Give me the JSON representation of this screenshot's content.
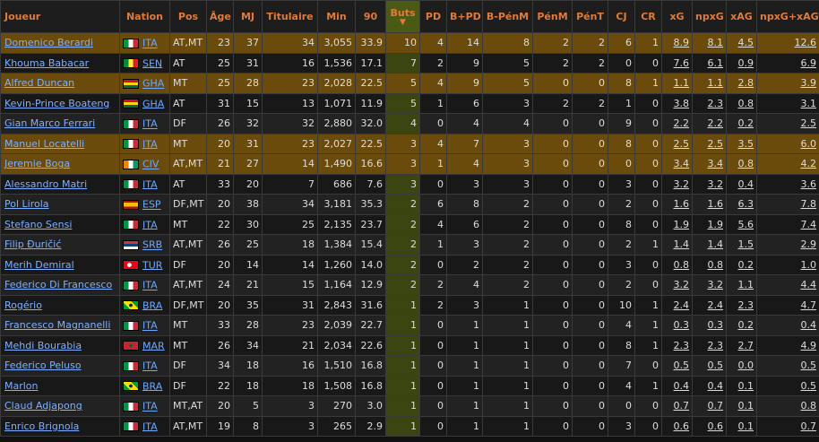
{
  "headers": {
    "player": "Joueur",
    "nation": "Nation",
    "pos": "Pos",
    "age": "Âge",
    "mj": "MJ",
    "tit": "Titulaire",
    "min": "Min",
    "n90": "90",
    "buts": "Buts",
    "sort_arrow": "▼",
    "pd": "PD",
    "bpd": "B+PD",
    "bpenm": "B-PénM",
    "penm": "PénM",
    "pent": "PénT",
    "cj": "CJ",
    "cr": "CR",
    "xg": "xG",
    "npxg": "npxG",
    "xag": "xAG",
    "npxgxag": "npxG+xAG"
  },
  "flags": {
    "ITA": {
      "type": "v",
      "colors": [
        "#009246",
        "#ffffff",
        "#ce2b37"
      ]
    },
    "SEN": {
      "type": "v",
      "colors": [
        "#00853f",
        "#fdef42",
        "#e31b23"
      ],
      "star": "#00853f"
    },
    "GHA": {
      "type": "h",
      "colors": [
        "#ce1126",
        "#fcd116",
        "#006b3f"
      ],
      "star": "#000000"
    },
    "CIV": {
      "type": "v",
      "colors": [
        "#f77f00",
        "#ffffff",
        "#009e60"
      ]
    },
    "ESP": {
      "type": "h3",
      "colors": [
        "#aa151b",
        "#f1bf00",
        "#aa151b"
      ]
    },
    "SRB": {
      "type": "h",
      "colors": [
        "#c6363c",
        "#0c4076",
        "#ffffff"
      ]
    },
    "TUR": {
      "type": "tur",
      "colors": [
        "#e30a17",
        "#ffffff"
      ]
    },
    "BRA": {
      "type": "bra",
      "colors": [
        "#009c3b",
        "#ffdf00",
        "#002776"
      ]
    },
    "MAR": {
      "type": "mar",
      "colors": [
        "#c1272d",
        "#006233"
      ]
    }
  },
  "rows": [
    {
      "name": "Domenico Berardi",
      "nat": "ITA",
      "pos": "AT,MT",
      "age": "23",
      "mj": "37",
      "tit": "34",
      "min": "3,055",
      "n90": "33.9",
      "buts": "10",
      "pd": "4",
      "bpd": "14",
      "bpenm": "8",
      "penm": "2",
      "pent": "2",
      "cj": "6",
      "cr": "1",
      "xg": "8.9",
      "npxg": "8.1",
      "xag": "4.5",
      "npxgxag": "12.6",
      "hl": true
    },
    {
      "name": "Khouma Babacar",
      "nat": "SEN",
      "pos": "AT",
      "age": "25",
      "mj": "31",
      "tit": "16",
      "min": "1,536",
      "n90": "17.1",
      "buts": "7",
      "pd": "2",
      "bpd": "9",
      "bpenm": "5",
      "penm": "2",
      "pent": "2",
      "cj": "0",
      "cr": "0",
      "xg": "7.6",
      "npxg": "6.1",
      "xag": "0.9",
      "npxgxag": "6.9",
      "hl": false
    },
    {
      "name": "Alfred Duncan",
      "nat": "GHA",
      "pos": "MT",
      "age": "25",
      "mj": "28",
      "tit": "23",
      "min": "2,028",
      "n90": "22.5",
      "buts": "5",
      "pd": "4",
      "bpd": "9",
      "bpenm": "5",
      "penm": "0",
      "pent": "0",
      "cj": "8",
      "cr": "1",
      "xg": "1.1",
      "npxg": "1.1",
      "xag": "2.8",
      "npxgxag": "3.9",
      "hl": true
    },
    {
      "name": "Kevin-Prince Boateng",
      "nat": "GHA",
      "pos": "AT",
      "age": "31",
      "mj": "15",
      "tit": "13",
      "min": "1,071",
      "n90": "11.9",
      "buts": "5",
      "pd": "1",
      "bpd": "6",
      "bpenm": "3",
      "penm": "2",
      "pent": "2",
      "cj": "1",
      "cr": "0",
      "xg": "3.8",
      "npxg": "2.3",
      "xag": "0.8",
      "npxgxag": "3.1",
      "hl": false
    },
    {
      "name": "Gian Marco Ferrari",
      "nat": "ITA",
      "pos": "DF",
      "age": "26",
      "mj": "32",
      "tit": "32",
      "min": "2,880",
      "n90": "32.0",
      "buts": "4",
      "pd": "0",
      "bpd": "4",
      "bpenm": "4",
      "penm": "0",
      "pent": "0",
      "cj": "9",
      "cr": "0",
      "xg": "2.2",
      "npxg": "2.2",
      "xag": "0.2",
      "npxgxag": "2.5",
      "hl": false
    },
    {
      "name": "Manuel Locatelli",
      "nat": "ITA",
      "pos": "MT",
      "age": "20",
      "mj": "31",
      "tit": "23",
      "min": "2,027",
      "n90": "22.5",
      "buts": "3",
      "pd": "4",
      "bpd": "7",
      "bpenm": "3",
      "penm": "0",
      "pent": "0",
      "cj": "8",
      "cr": "0",
      "xg": "2.5",
      "npxg": "2.5",
      "xag": "3.5",
      "npxgxag": "6.0",
      "hl": true
    },
    {
      "name": "Jeremie Boga",
      "nat": "CIV",
      "pos": "AT,MT",
      "age": "21",
      "mj": "27",
      "tit": "14",
      "min": "1,490",
      "n90": "16.6",
      "buts": "3",
      "pd": "1",
      "bpd": "4",
      "bpenm": "3",
      "penm": "0",
      "pent": "0",
      "cj": "0",
      "cr": "0",
      "xg": "3.4",
      "npxg": "3.4",
      "xag": "0.8",
      "npxgxag": "4.2",
      "hl": true
    },
    {
      "name": "Alessandro Matri",
      "nat": "ITA",
      "pos": "AT",
      "age": "33",
      "mj": "20",
      "tit": "7",
      "min": "686",
      "n90": "7.6",
      "buts": "3",
      "pd": "0",
      "bpd": "3",
      "bpenm": "3",
      "penm": "0",
      "pent": "0",
      "cj": "3",
      "cr": "0",
      "xg": "3.2",
      "npxg": "3.2",
      "xag": "0.4",
      "npxgxag": "3.6",
      "hl": false
    },
    {
      "name": "Pol Lirola",
      "nat": "ESP",
      "pos": "DF,MT",
      "age": "20",
      "mj": "38",
      "tit": "34",
      "min": "3,181",
      "n90": "35.3",
      "buts": "2",
      "pd": "6",
      "bpd": "8",
      "bpenm": "2",
      "penm": "0",
      "pent": "0",
      "cj": "2",
      "cr": "0",
      "xg": "1.6",
      "npxg": "1.6",
      "xag": "6.3",
      "npxgxag": "7.8",
      "hl": false
    },
    {
      "name": "Stefano Sensi",
      "nat": "ITA",
      "pos": "MT",
      "age": "22",
      "mj": "30",
      "tit": "25",
      "min": "2,135",
      "n90": "23.7",
      "buts": "2",
      "pd": "4",
      "bpd": "6",
      "bpenm": "2",
      "penm": "0",
      "pent": "0",
      "cj": "8",
      "cr": "0",
      "xg": "1.9",
      "npxg": "1.9",
      "xag": "5.6",
      "npxgxag": "7.4",
      "hl": false
    },
    {
      "name": "Filip Đuričić",
      "nat": "SRB",
      "pos": "AT,MT",
      "age": "26",
      "mj": "25",
      "tit": "18",
      "min": "1,384",
      "n90": "15.4",
      "buts": "2",
      "pd": "1",
      "bpd": "3",
      "bpenm": "2",
      "penm": "0",
      "pent": "0",
      "cj": "2",
      "cr": "1",
      "xg": "1.4",
      "npxg": "1.4",
      "xag": "1.5",
      "npxgxag": "2.9",
      "hl": false
    },
    {
      "name": "Merih Demiral",
      "nat": "TUR",
      "pos": "DF",
      "age": "20",
      "mj": "14",
      "tit": "14",
      "min": "1,260",
      "n90": "14.0",
      "buts": "2",
      "pd": "0",
      "bpd": "2",
      "bpenm": "2",
      "penm": "0",
      "pent": "0",
      "cj": "3",
      "cr": "0",
      "xg": "0.8",
      "npxg": "0.8",
      "xag": "0.2",
      "npxgxag": "1.0",
      "hl": false
    },
    {
      "name": "Federico Di Francesco",
      "nat": "ITA",
      "pos": "AT,MT",
      "age": "24",
      "mj": "21",
      "tit": "15",
      "min": "1,164",
      "n90": "12.9",
      "buts": "2",
      "pd": "2",
      "bpd": "4",
      "bpenm": "2",
      "penm": "0",
      "pent": "0",
      "cj": "2",
      "cr": "0",
      "xg": "3.2",
      "npxg": "3.2",
      "xag": "1.1",
      "npxgxag": "4.4",
      "hl": false
    },
    {
      "name": "Rogério",
      "nat": "BRA",
      "pos": "DF,MT",
      "age": "20",
      "mj": "35",
      "tit": "31",
      "min": "2,843",
      "n90": "31.6",
      "buts": "1",
      "pd": "2",
      "bpd": "3",
      "bpenm": "1",
      "penm": "0",
      "pent": "0",
      "cj": "10",
      "cr": "1",
      "xg": "2.4",
      "npxg": "2.4",
      "xag": "2.3",
      "npxgxag": "4.7",
      "hl": false
    },
    {
      "name": "Francesco Magnanelli",
      "nat": "ITA",
      "pos": "MT",
      "age": "33",
      "mj": "28",
      "tit": "23",
      "min": "2,039",
      "n90": "22.7",
      "buts": "1",
      "pd": "0",
      "bpd": "1",
      "bpenm": "1",
      "penm": "0",
      "pent": "0",
      "cj": "4",
      "cr": "1",
      "xg": "0.3",
      "npxg": "0.3",
      "xag": "0.2",
      "npxgxag": "0.4",
      "hl": false
    },
    {
      "name": "Mehdi Bourabia",
      "nat": "MAR",
      "pos": "MT",
      "age": "26",
      "mj": "34",
      "tit": "21",
      "min": "2,034",
      "n90": "22.6",
      "buts": "1",
      "pd": "0",
      "bpd": "1",
      "bpenm": "1",
      "penm": "0",
      "pent": "0",
      "cj": "8",
      "cr": "1",
      "xg": "2.3",
      "npxg": "2.3",
      "xag": "2.7",
      "npxgxag": "4.9",
      "hl": false
    },
    {
      "name": "Federico Peluso",
      "nat": "ITA",
      "pos": "DF",
      "age": "34",
      "mj": "18",
      "tit": "16",
      "min": "1,510",
      "n90": "16.8",
      "buts": "1",
      "pd": "0",
      "bpd": "1",
      "bpenm": "1",
      "penm": "0",
      "pent": "0",
      "cj": "7",
      "cr": "0",
      "xg": "0.5",
      "npxg": "0.5",
      "xag": "0.0",
      "npxgxag": "0.5",
      "hl": false
    },
    {
      "name": "Marlon",
      "nat": "BRA",
      "pos": "DF",
      "age": "22",
      "mj": "18",
      "tit": "18",
      "min": "1,508",
      "n90": "16.8",
      "buts": "1",
      "pd": "0",
      "bpd": "1",
      "bpenm": "1",
      "penm": "0",
      "pent": "0",
      "cj": "4",
      "cr": "1",
      "xg": "0.4",
      "npxg": "0.4",
      "xag": "0.1",
      "npxgxag": "0.5",
      "hl": false
    },
    {
      "name": "Claud Adjapong",
      "nat": "ITA",
      "pos": "MT,AT",
      "age": "20",
      "mj": "5",
      "tit": "3",
      "min": "270",
      "n90": "3.0",
      "buts": "1",
      "pd": "0",
      "bpd": "1",
      "bpenm": "1",
      "penm": "0",
      "pent": "0",
      "cj": "0",
      "cr": "0",
      "xg": "0.7",
      "npxg": "0.7",
      "xag": "0.1",
      "npxgxag": "0.8",
      "hl": false
    },
    {
      "name": "Enrico Brignola",
      "nat": "ITA",
      "pos": "AT,MT",
      "age": "19",
      "mj": "8",
      "tit": "3",
      "min": "265",
      "n90": "2.9",
      "buts": "1",
      "pd": "0",
      "bpd": "1",
      "bpenm": "1",
      "penm": "0",
      "pent": "0",
      "cj": "3",
      "cr": "0",
      "xg": "0.6",
      "npxg": "0.6",
      "xag": "0.1",
      "npxgxag": "0.7",
      "hl": false
    }
  ]
}
